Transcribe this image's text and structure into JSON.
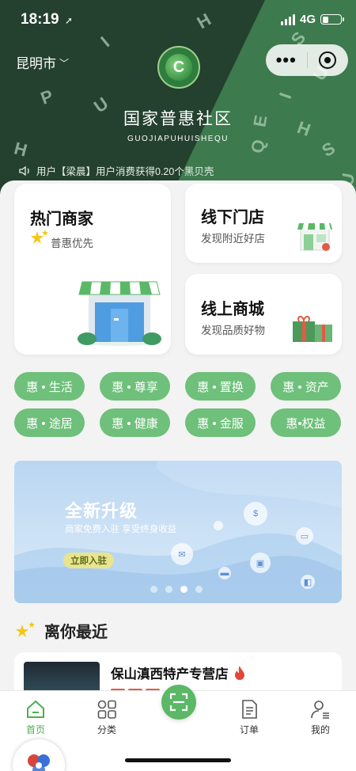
{
  "status_bar": {
    "time": "18:19",
    "network": "4G"
  },
  "header": {
    "city": "昆明市",
    "brand_title": "国家普惠社区",
    "brand_subtitle": "GUOJIAPUHUISHEQU",
    "notice": "用户【梁晨】用户消费获得0.20个黑贝壳",
    "deco_letters": [
      "P",
      "H",
      "U",
      "I",
      "H",
      "S",
      "U",
      "I",
      "Q",
      "E",
      "H",
      "S",
      "U"
    ]
  },
  "cards": {
    "hot": {
      "title": "热门商家",
      "subtitle": "普惠优先"
    },
    "offline": {
      "title": "线下门店",
      "subtitle": "发现附近好店"
    },
    "online": {
      "title": "线上商城",
      "subtitle": "发现品质好物"
    }
  },
  "categories": [
    "惠 • 生活",
    "惠 • 尊享",
    "惠 • 置换",
    "惠 • 资产",
    "惠 • 途居",
    "惠 • 健康",
    "惠 • 金服",
    "惠•权益"
  ],
  "banner": {
    "title": "全新升级",
    "subtitle": "商家免费入驻 享受终身收益",
    "button": "立即入驻",
    "slides": 4,
    "active_slide": 3
  },
  "nearby": {
    "section_title": "离你最近",
    "shop_name": "保山滇西特产专营店"
  },
  "tabbar": {
    "items": [
      {
        "label": "首页",
        "icon": "home-icon",
        "active": true
      },
      {
        "label": "分类",
        "icon": "category-icon",
        "active": false
      },
      {
        "label": "",
        "icon": "scan-icon",
        "active": false
      },
      {
        "label": "订单",
        "icon": "order-icon",
        "active": false
      },
      {
        "label": "我的",
        "icon": "profile-icon",
        "active": false
      }
    ]
  },
  "colors": {
    "primary": "#5ab866",
    "header_dark": "#24402e",
    "header_light": "#3d7a4d"
  }
}
